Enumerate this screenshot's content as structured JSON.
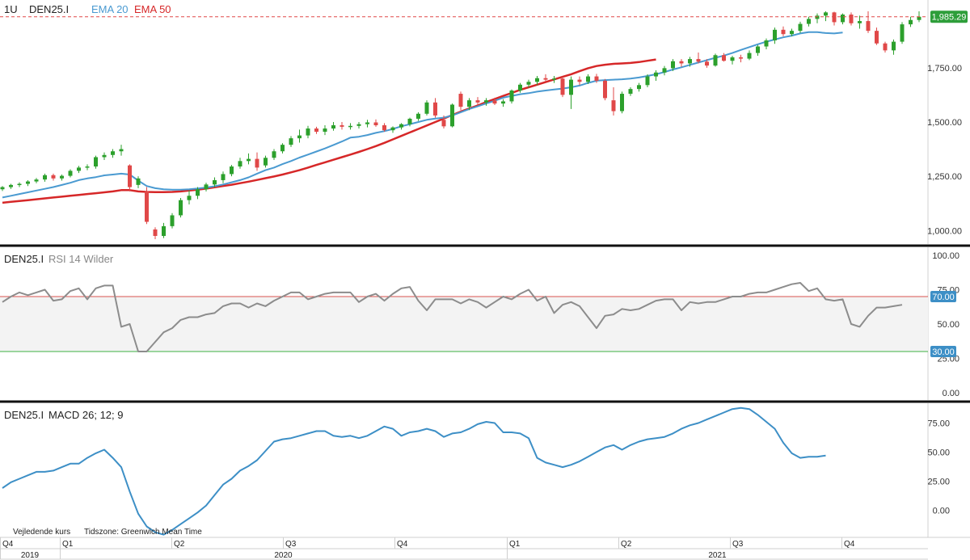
{
  "price_panel": {
    "interval": "1U",
    "symbol": "DEN25.I",
    "ema20_label": "EMA 20",
    "ema50_label": "EMA 50",
    "last_price_label": "1,985.29",
    "y_ticks": [
      "1,000.00",
      "1,250.00",
      "1,500.00",
      "1,750.00"
    ]
  },
  "rsi_panel": {
    "symbol": "DEN25.I",
    "indicator_label": "RSI 14 Wilder",
    "y_ticks": [
      "0.00",
      "25.00",
      "50.00",
      "75.00",
      "100.00"
    ],
    "upper_label": "70.00",
    "lower_label": "30.00"
  },
  "macd_panel": {
    "symbol": "DEN25.I",
    "indicator_label": "MACD 26; 12; 9",
    "y_ticks": [
      "0.00",
      "25.00",
      "50.00",
      "75.00"
    ]
  },
  "footer": {
    "note": "Vejledende kurs",
    "timezone": "Tidszone: Greenwich Mean Time",
    "quarters": [
      "Q4",
      "Q1",
      "Q2",
      "Q3",
      "Q4",
      "Q1",
      "Q2",
      "Q3",
      "Q4"
    ],
    "years": [
      "2019",
      "2020",
      "2021"
    ]
  },
  "colors": {
    "up": "#2ca02c",
    "down": "#e04848",
    "ema20": "#4a9ad1",
    "ema50": "#d62728",
    "rsi": "#8c8c8c",
    "macd": "#3d8fc6",
    "last_price_bg": "#2e9e3a",
    "rsi_band_label_bg": "#3d8fc6"
  },
  "chart_data": [
    {
      "type": "candlestick",
      "title": "DEN25.I",
      "interval": "weekly",
      "ylim": [
        960,
        2010
      ],
      "candles": [
        [
          1190,
          1205,
          1182,
          1200
        ],
        [
          1200,
          1215,
          1192,
          1210
        ],
        [
          1210,
          1222,
          1200,
          1215
        ],
        [
          1215,
          1232,
          1205,
          1226
        ],
        [
          1226,
          1242,
          1218,
          1235
        ],
        [
          1235,
          1262,
          1225,
          1255
        ],
        [
          1255,
          1262,
          1230,
          1240
        ],
        [
          1240,
          1258,
          1230,
          1252
        ],
        [
          1252,
          1282,
          1245,
          1275
        ],
        [
          1275,
          1298,
          1265,
          1290
        ],
        [
          1290,
          1305,
          1278,
          1295
        ],
        [
          1295,
          1345,
          1285,
          1338
        ],
        [
          1338,
          1360,
          1325,
          1348
        ],
        [
          1348,
          1375,
          1335,
          1365
        ],
        [
          1365,
          1395,
          1345,
          1375
        ],
        [
          1300,
          1305,
          1180,
          1200
        ],
        [
          1210,
          1250,
          1195,
          1240
        ],
        [
          1180,
          1200,
          1030,
          1040
        ],
        [
          1005,
          1015,
          960,
          975
        ],
        [
          975,
          1035,
          965,
          1020
        ],
        [
          1020,
          1080,
          1010,
          1070
        ],
        [
          1070,
          1150,
          1060,
          1140
        ],
        [
          1140,
          1185,
          1120,
          1160
        ],
        [
          1160,
          1200,
          1145,
          1190
        ],
        [
          1190,
          1220,
          1180,
          1212
        ],
        [
          1212,
          1245,
          1200,
          1232
        ],
        [
          1232,
          1272,
          1218,
          1260
        ],
        [
          1260,
          1302,
          1250,
          1295
        ],
        [
          1295,
          1335,
          1285,
          1320
        ],
        [
          1320,
          1355,
          1305,
          1330
        ],
        [
          1330,
          1360,
          1275,
          1290
        ],
        [
          1300,
          1345,
          1290,
          1335
        ],
        [
          1335,
          1375,
          1325,
          1365
        ],
        [
          1365,
          1402,
          1355,
          1395
        ],
        [
          1395,
          1435,
          1385,
          1425
        ],
        [
          1425,
          1465,
          1405,
          1438
        ],
        [
          1438,
          1482,
          1425,
          1470
        ],
        [
          1470,
          1478,
          1445,
          1455
        ],
        [
          1455,
          1485,
          1440,
          1470
        ],
        [
          1470,
          1500,
          1460,
          1485
        ],
        [
          1485,
          1500,
          1465,
          1478
        ],
        [
          1478,
          1495,
          1465,
          1482
        ],
        [
          1482,
          1500,
          1470,
          1490
        ],
        [
          1490,
          1510,
          1475,
          1498
        ],
        [
          1498,
          1512,
          1478,
          1485
        ],
        [
          1485,
          1495,
          1455,
          1462
        ],
        [
          1462,
          1480,
          1450,
          1475
        ],
        [
          1475,
          1495,
          1465,
          1490
        ],
        [
          1490,
          1520,
          1480,
          1515
        ],
        [
          1515,
          1545,
          1505,
          1538
        ],
        [
          1538,
          1600,
          1530,
          1590
        ],
        [
          1590,
          1610,
          1520,
          1530
        ],
        [
          1510,
          1530,
          1470,
          1480
        ],
        [
          1480,
          1585,
          1475,
          1580
        ],
        [
          1630,
          1640,
          1555,
          1570
        ],
        [
          1570,
          1610,
          1555,
          1600
        ],
        [
          1600,
          1615,
          1580,
          1590
        ],
        [
          1590,
          1610,
          1575,
          1600
        ],
        [
          1600,
          1612,
          1578,
          1585
        ],
        [
          1585,
          1605,
          1570,
          1595
        ],
        [
          1595,
          1650,
          1585,
          1645
        ],
        [
          1645,
          1680,
          1635,
          1672
        ],
        [
          1672,
          1695,
          1658,
          1685
        ],
        [
          1685,
          1712,
          1670,
          1702
        ],
        [
          1702,
          1720,
          1685,
          1695
        ],
        [
          1695,
          1712,
          1680,
          1700
        ],
        [
          1700,
          1708,
          1615,
          1625
        ],
        [
          1625,
          1710,
          1560,
          1695
        ],
        [
          1695,
          1710,
          1670,
          1685
        ],
        [
          1685,
          1720,
          1675,
          1710
        ],
        [
          1710,
          1722,
          1680,
          1690
        ],
        [
          1690,
          1698,
          1600,
          1610
        ],
        [
          1600,
          1660,
          1530,
          1550
        ],
        [
          1550,
          1640,
          1540,
          1630
        ],
        [
          1630,
          1660,
          1620,
          1652
        ],
        [
          1652,
          1680,
          1640,
          1670
        ],
        [
          1670,
          1720,
          1660,
          1710
        ],
        [
          1710,
          1738,
          1690,
          1728
        ],
        [
          1728,
          1758,
          1715,
          1748
        ],
        [
          1748,
          1790,
          1735,
          1780
        ],
        [
          1780,
          1790,
          1755,
          1770
        ],
        [
          1770,
          1800,
          1755,
          1790
        ],
        [
          1790,
          1820,
          1770,
          1778
        ],
        [
          1778,
          1790,
          1750,
          1760
        ],
        [
          1760,
          1815,
          1755,
          1808
        ],
        [
          1808,
          1818,
          1778,
          1782
        ],
        [
          1782,
          1805,
          1765,
          1798
        ],
        [
          1798,
          1810,
          1775,
          1792
        ],
        [
          1792,
          1830,
          1785,
          1818
        ],
        [
          1818,
          1855,
          1805,
          1848
        ],
        [
          1848,
          1885,
          1835,
          1876
        ],
        [
          1876,
          1935,
          1860,
          1925
        ],
        [
          1925,
          1940,
          1895,
          1905
        ],
        [
          1905,
          1930,
          1895,
          1920
        ],
        [
          1920,
          1962,
          1910,
          1952
        ],
        [
          1952,
          1985,
          1940,
          1975
        ],
        [
          1975,
          2000,
          1955,
          1990
        ],
        [
          1990,
          2010,
          1965,
          2005
        ],
        [
          2005,
          2008,
          1945,
          1960
        ],
        [
          1960,
          2000,
          1950,
          1995
        ],
        [
          1995,
          2005,
          1945,
          1955
        ],
        [
          1955,
          1990,
          1930,
          1965
        ],
        [
          1965,
          2010,
          1910,
          1920
        ],
        [
          1920,
          1935,
          1855,
          1862
        ],
        [
          1862,
          1870,
          1820,
          1830
        ],
        [
          1830,
          1880,
          1810,
          1870
        ],
        [
          1870,
          1960,
          1860,
          1950
        ],
        [
          1950,
          1985,
          1938,
          1970
        ],
        [
          1970,
          2010,
          1960,
          1985
        ]
      ],
      "series": [
        {
          "name": "EMA 20",
          "values": [
            1152,
            1160,
            1168,
            1176,
            1184,
            1192,
            1200,
            1210,
            1220,
            1232,
            1240,
            1246,
            1254,
            1258,
            1262,
            1258,
            1230,
            1205,
            1195,
            1190,
            1188,
            1188,
            1190,
            1194,
            1198,
            1204,
            1212,
            1222,
            1232,
            1245,
            1262,
            1278,
            1290,
            1306,
            1320,
            1336,
            1350,
            1364,
            1378,
            1394,
            1410,
            1428,
            1432,
            1440,
            1450,
            1458,
            1468,
            1480,
            1490,
            1500,
            1510,
            1516,
            1520,
            1530,
            1545,
            1560,
            1572,
            1585,
            1598,
            1612,
            1620,
            1628,
            1633,
            1640,
            1645,
            1650,
            1654,
            1660,
            1668,
            1680,
            1690,
            1693,
            1695,
            1697,
            1700,
            1705,
            1712,
            1720,
            1730,
            1742,
            1752,
            1763,
            1774,
            1785,
            1796,
            1806,
            1818,
            1832,
            1845,
            1858,
            1870,
            1880,
            1890,
            1898,
            1908,
            1914,
            1914,
            1910,
            1908,
            1912
          ]
        },
        {
          "name": "EMA 50",
          "values": [
            1128,
            1132,
            1136,
            1140,
            1144,
            1148,
            1152,
            1156,
            1160,
            1164,
            1168,
            1172,
            1176,
            1180,
            1186,
            1186,
            1180,
            1178,
            1177,
            1177,
            1178,
            1180,
            1184,
            1188,
            1193,
            1199,
            1205,
            1211,
            1218,
            1225,
            1233,
            1241,
            1249,
            1258,
            1268,
            1278,
            1290,
            1302,
            1314,
            1326,
            1338,
            1350,
            1362,
            1375,
            1389,
            1404,
            1420,
            1436,
            1452,
            1468,
            1484,
            1500,
            1516,
            1532,
            1548,
            1562,
            1576,
            1592,
            1606,
            1620,
            1634,
            1648,
            1660,
            1672,
            1684,
            1696,
            1708,
            1720,
            1734,
            1748,
            1758,
            1764,
            1768,
            1770,
            1772,
            1776,
            1782,
            1788
          ]
        }
      ]
    },
    {
      "type": "line",
      "title": "RSI 14 Wilder",
      "ylim": [
        0,
        100
      ],
      "upper_band": 70,
      "lower_band": 30,
      "series": [
        {
          "name": "RSI 14 Wilder",
          "values": [
            66,
            70,
            73,
            71,
            73,
            75,
            67,
            68,
            74,
            76,
            68,
            76,
            78,
            78,
            48,
            50,
            30,
            30,
            37,
            44,
            47,
            53,
            55,
            55,
            57,
            58,
            63,
            65,
            65,
            62,
            65,
            63,
            67,
            70,
            73,
            73,
            68,
            70,
            72,
            73,
            73,
            73,
            66,
            70,
            72,
            67,
            72,
            76,
            77,
            67,
            60,
            68,
            68,
            68,
            65,
            68,
            66,
            62,
            66,
            70,
            68,
            72,
            75,
            67,
            70,
            58,
            64,
            66,
            63,
            55,
            47,
            56,
            57,
            61,
            60,
            61,
            64,
            67,
            68,
            68,
            60,
            66,
            65,
            66,
            66,
            68,
            70,
            70,
            72,
            73,
            73,
            75,
            77,
            79,
            80,
            74,
            76,
            68,
            67,
            68,
            50,
            48,
            56,
            62,
            62,
            63,
            64
          ]
        }
      ]
    },
    {
      "type": "line",
      "title": "MACD 26; 12; 9",
      "ylim": [
        -22,
        92
      ],
      "series": [
        {
          "name": "MACD 26; 12; 9",
          "values": [
            19,
            24,
            27,
            30,
            33,
            33,
            34,
            37,
            40,
            40,
            45,
            49,
            52,
            45,
            37,
            16,
            -3,
            -14,
            -19,
            -21,
            -17,
            -12,
            -7,
            -2,
            4,
            13,
            22,
            27,
            34,
            38,
            43,
            51,
            59,
            61,
            62,
            64,
            66,
            68,
            68,
            64,
            63,
            64,
            62,
            64,
            68,
            72,
            70,
            64,
            67,
            68,
            70,
            68,
            63,
            66,
            67,
            70,
            74,
            76,
            75,
            67,
            67,
            66,
            62,
            45,
            41,
            39,
            37,
            39,
            42,
            46,
            50,
            54,
            56,
            52,
            56,
            59,
            61,
            62,
            63,
            66,
            70,
            73,
            75,
            78,
            81,
            84,
            87,
            88,
            87,
            82,
            76,
            70,
            58,
            49,
            45,
            46,
            46,
            47
          ]
        }
      ]
    }
  ]
}
